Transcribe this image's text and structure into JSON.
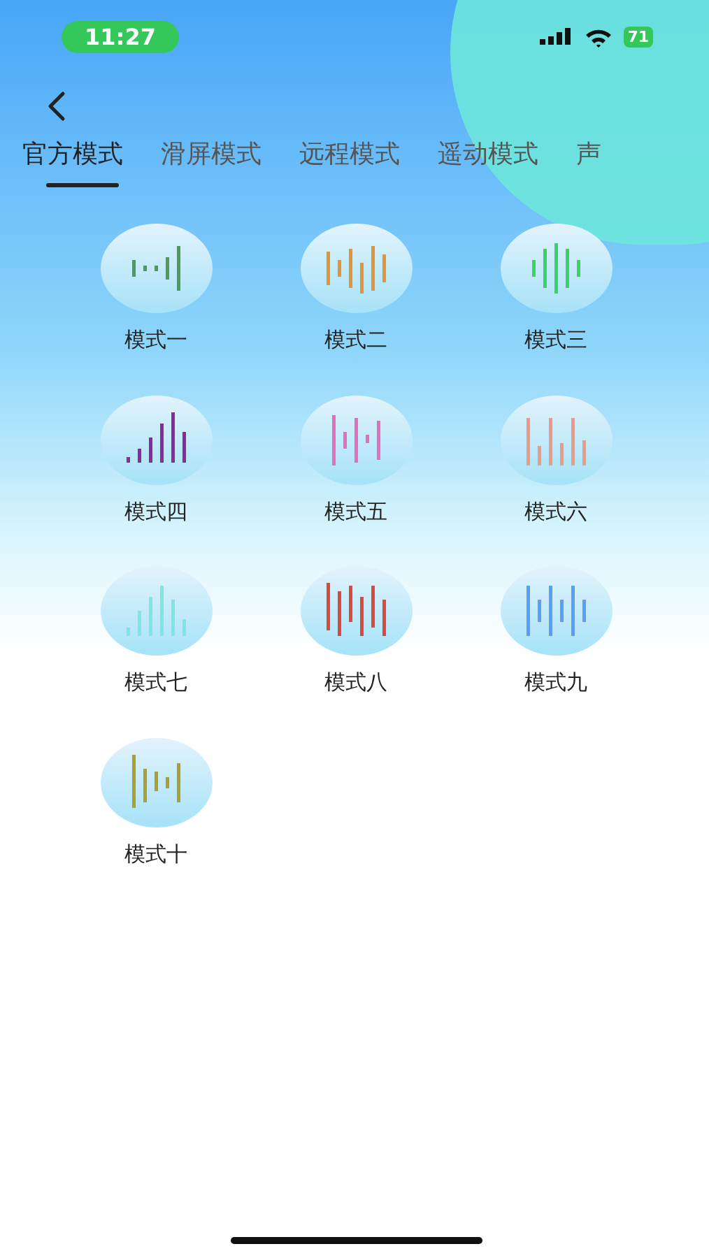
{
  "status_bar": {
    "time": "11:27",
    "battery": "71"
  },
  "tabs": [
    {
      "label": "官方模式",
      "selected": true
    },
    {
      "label": "滑屏模式",
      "selected": false
    },
    {
      "label": "远程模式",
      "selected": false
    },
    {
      "label": "遥动模式",
      "selected": false
    },
    {
      "label": "声",
      "selected": false
    }
  ],
  "modes": [
    {
      "label": "模式一",
      "color": "#4e9a5a"
    },
    {
      "label": "模式二",
      "color": "#e0953a"
    },
    {
      "label": "模式三",
      "color": "#3ccf6a"
    },
    {
      "label": "模式四",
      "color": "#8a2a9a"
    },
    {
      "label": "模式五",
      "color": "#e070b8"
    },
    {
      "label": "模式六",
      "color": "#ec9a88"
    },
    {
      "label": "模式七",
      "color": "#7ee6e0"
    },
    {
      "label": "模式八",
      "color": "#d84a3a"
    },
    {
      "label": "模式九",
      "color": "#5aa0f0"
    },
    {
      "label": "模式十",
      "color": "#a8a030"
    }
  ]
}
